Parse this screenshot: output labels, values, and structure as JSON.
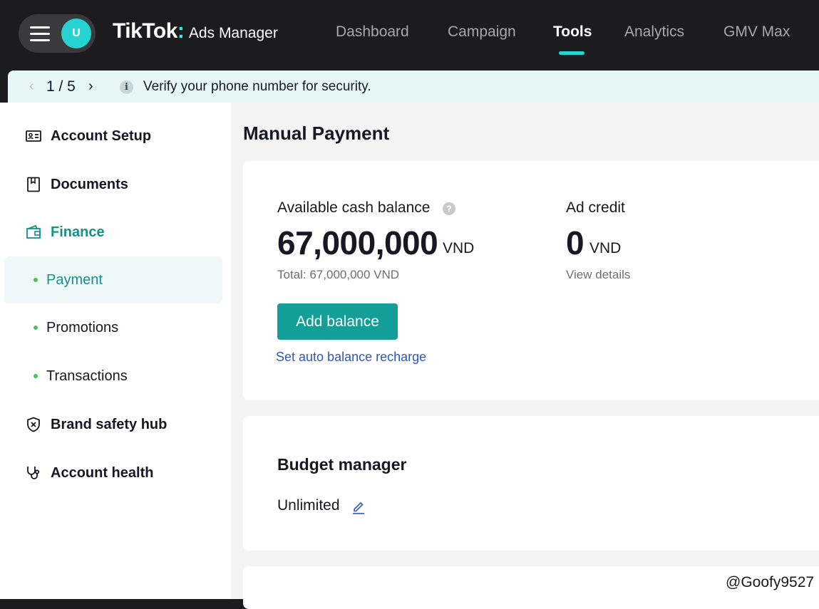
{
  "header": {
    "avatar_initial": "U",
    "logo_brand": "TikTok",
    "logo_colon": ":",
    "logo_product": "Ads Manager",
    "nav": [
      {
        "label": "Dashboard",
        "active": false
      },
      {
        "label": "Campaign",
        "active": false
      },
      {
        "label": "Tools",
        "active": true
      },
      {
        "label": "Analytics",
        "active": false
      },
      {
        "label": "GMV Max",
        "active": false
      }
    ],
    "accent_color": "#25d4d0"
  },
  "notice": {
    "pager": "1 / 5",
    "message": "Verify your phone number for security."
  },
  "sidebar": {
    "items": [
      {
        "label": "Account Setup",
        "icon": "id-card-icon"
      },
      {
        "label": "Documents",
        "icon": "document-icon"
      },
      {
        "label": "Finance",
        "icon": "wallet-icon",
        "active": true
      },
      {
        "label": "Brand safety hub",
        "icon": "shield-x-icon"
      },
      {
        "label": "Account health",
        "icon": "stethoscope-icon"
      }
    ],
    "finance_sub": [
      {
        "label": "Payment",
        "active": true
      },
      {
        "label": "Promotions",
        "active": false
      },
      {
        "label": "Transactions",
        "active": false
      }
    ]
  },
  "main": {
    "title": "Manual Payment",
    "balance": {
      "label": "Available cash balance",
      "amount": "67,000,000",
      "currency": "VND",
      "total": "Total: 67,000,000 VND",
      "add_button": "Add balance",
      "auto_link": "Set auto balance recharge"
    },
    "ad_credit": {
      "label": "Ad credit",
      "amount": "0",
      "currency": "VND",
      "details_link": "View details"
    },
    "budget": {
      "title": "Budget manager",
      "value": "Unlimited"
    }
  },
  "watermark": "@Goofy9527",
  "colors": {
    "primary": "#139f97",
    "link": "#2f55c7",
    "notice_bg": "#e6f7f8"
  }
}
